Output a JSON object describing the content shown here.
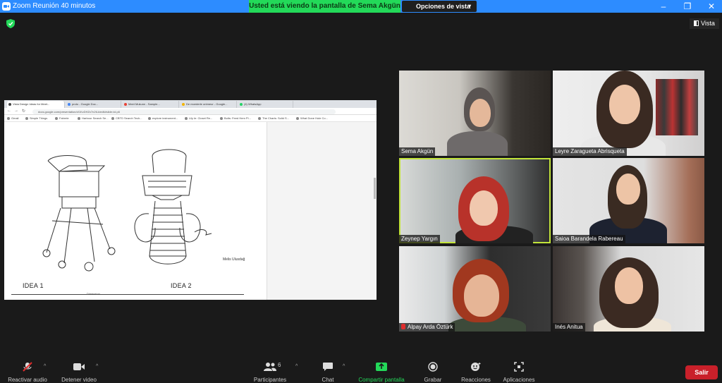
{
  "window": {
    "title": "Zoom Reunión 40 minutos"
  },
  "share_banner": {
    "text": "Usted está viendo la pantalla de Sema Akgün"
  },
  "view_options": {
    "label": "Opciones de vista"
  },
  "vista_button": {
    "label": "Vista"
  },
  "shared_screen": {
    "tabs": [
      "Vista Design Ideas for Meet...",
      "proto - Google Doc...",
      "Meet Mukunn - Sample...",
      "De moederle ontmeur - Google...",
      "(4) WhatsApp"
    ],
    "url": "docs.google.com/presentation/d/1KzDHZx7n2tLk/edit#slide=id.p6",
    "bookmarks": [
      "Gmail",
      "Simple Things",
      "Fahrele",
      "Harbour Search Se...",
      "CBTD Search Tech...",
      "explore instrument...",
      "Lily le: Closet Re...",
      "Bolts: Feed Hem Pl...",
      "The Charts: Solid S...",
      "What Done Hole Co..."
    ],
    "idea1": "IDEA 1",
    "idea2": "IDEA 2",
    "author": "Melis Ulusdağ",
    "dimension_note": "Dimension"
  },
  "participants_tiles": [
    {
      "name": "Sema Akgün",
      "muted": false
    },
    {
      "name": "Leyre Zaragueta Abrisqueta",
      "muted": false
    },
    {
      "name": "Zeynep Yargın",
      "muted": false,
      "active_speaker": true
    },
    {
      "name": "Saioa Barandela Rabereau",
      "muted": false
    },
    {
      "name": "Alpay Arda Öztürk",
      "muted": true
    },
    {
      "name": "Inés Anitua",
      "muted": false
    }
  ],
  "toolbar": {
    "audio": "Reactivar audio",
    "video": "Detener video",
    "participants": "Participantes",
    "participants_count": "6",
    "chat": "Chat",
    "share": "Compartir pantalla",
    "record": "Grabar",
    "reactions": "Reacciones",
    "apps": "Aplicaciones",
    "leave": "Salir"
  },
  "colors": {
    "zoom_blue": "#2d8cff",
    "share_green": "#23d959",
    "leave_red": "#c9202a",
    "active_outline": "#c2e43a"
  }
}
